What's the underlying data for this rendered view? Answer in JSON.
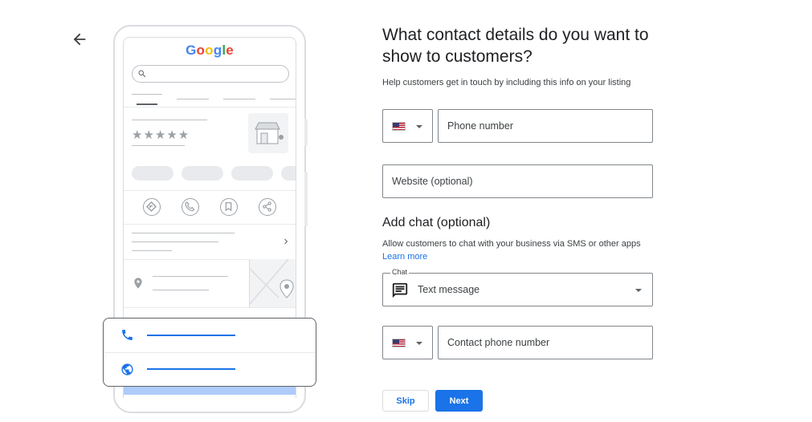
{
  "illustration": {
    "logo": [
      "G",
      "o",
      "o",
      "g",
      "l",
      "e"
    ],
    "stars": "★★★★★"
  },
  "form": {
    "title": "What contact details do you want to show to customers?",
    "subtitle": "Help customers get in touch by including this info on your listing",
    "phone": {
      "country_flag": "us-flag-icon",
      "placeholder": "Phone number",
      "value": ""
    },
    "website": {
      "placeholder": "Website (optional)",
      "value": ""
    },
    "chat_section": {
      "heading": "Add chat (optional)",
      "description": "Allow customers to chat with your business via SMS or other apps",
      "learn_more": "Learn more",
      "select_label": "Chat",
      "select_value": "Text message",
      "contact_phone": {
        "country_flag": "us-flag-icon",
        "placeholder": "Contact phone number",
        "value": ""
      }
    },
    "buttons": {
      "skip": "Skip",
      "next": "Next"
    }
  },
  "colors": {
    "accent": "#1a73e8",
    "border": "#80868b",
    "text": "#202124"
  }
}
